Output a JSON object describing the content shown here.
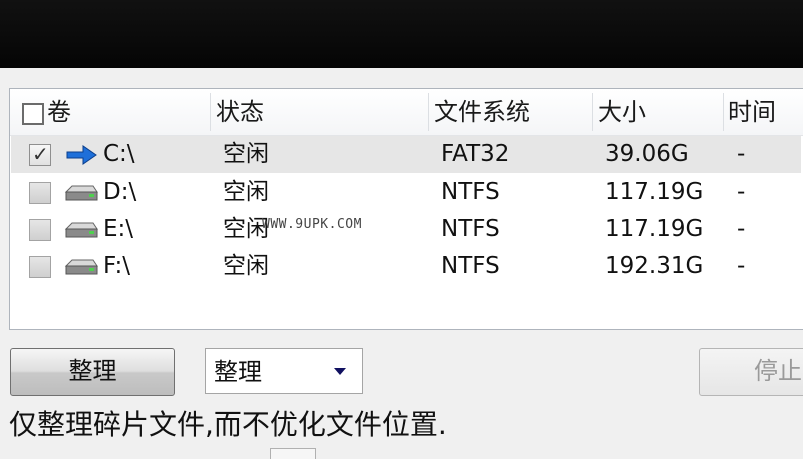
{
  "list": {
    "columns": {
      "volume": "卷",
      "status": "状态",
      "filesystem": "文件系统",
      "size": "大小",
      "time": "时间"
    },
    "rows": [
      {
        "checked": true,
        "icon": "blue-arrow-icon",
        "volume": "C:\\",
        "status": "空闲",
        "filesystem": "FAT32",
        "size": "39.06G",
        "time": "-"
      },
      {
        "checked": false,
        "icon": "hard-drive-icon",
        "volume": "D:\\",
        "status": "空闲",
        "filesystem": "NTFS",
        "size": "117.19G",
        "time": "-"
      },
      {
        "checked": false,
        "icon": "hard-drive-icon",
        "volume": "E:\\",
        "status": "空闲",
        "filesystem": "NTFS",
        "size": "117.19G",
        "time": "-"
      },
      {
        "checked": false,
        "icon": "hard-drive-icon",
        "volume": "F:\\",
        "status": "空闲",
        "filesystem": "NTFS",
        "size": "192.31G",
        "time": "-"
      }
    ],
    "selected_row": 0,
    "checkmark": "✓"
  },
  "watermark": "WWW.9UPK.COM",
  "controls": {
    "defrag_button": "整理",
    "mode_value": "整理",
    "stop_button": "停止"
  },
  "description": "仅整理碎片文件,而不优化文件位置.",
  "colors": {
    "selected_row": "#e6e6e6",
    "arrow_blue": "#1e6fd9",
    "titlebar": "#0a0a0a"
  }
}
